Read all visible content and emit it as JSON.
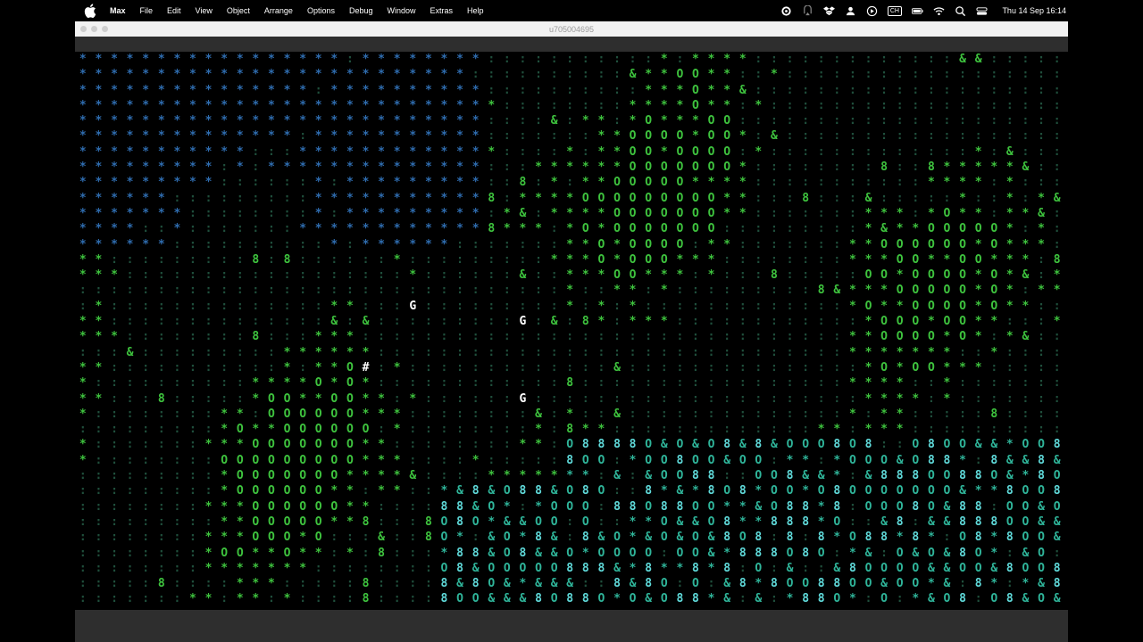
{
  "menubar": {
    "app_name": "Max",
    "menus": [
      "File",
      "Edit",
      "View",
      "Object",
      "Arrange",
      "Options",
      "Debug",
      "Window",
      "Extras",
      "Help"
    ],
    "status_icons": [
      "gear-icon",
      "airplay-icon",
      "dropbox-icon",
      "user-icon",
      "play-icon",
      "input-source-icon",
      "battery-icon",
      "wifi-icon",
      "search-icon",
      "control-center-icon"
    ],
    "input_source": "CH",
    "clock": "Thu 14 Sep  16:14"
  },
  "window": {
    "title": "u705004695"
  },
  "canvas": {
    "description_glyphs": [
      ":",
      "*",
      "O",
      "8",
      "&",
      "G",
      "#"
    ],
    "colors": {
      "blue": "#2f6db0",
      "green": "#3ec33e",
      "teal": "#2fb59a",
      "cyan": "#5fd9d9",
      "dim": "#1f4f3c",
      "white": "#ffffff"
    }
  }
}
